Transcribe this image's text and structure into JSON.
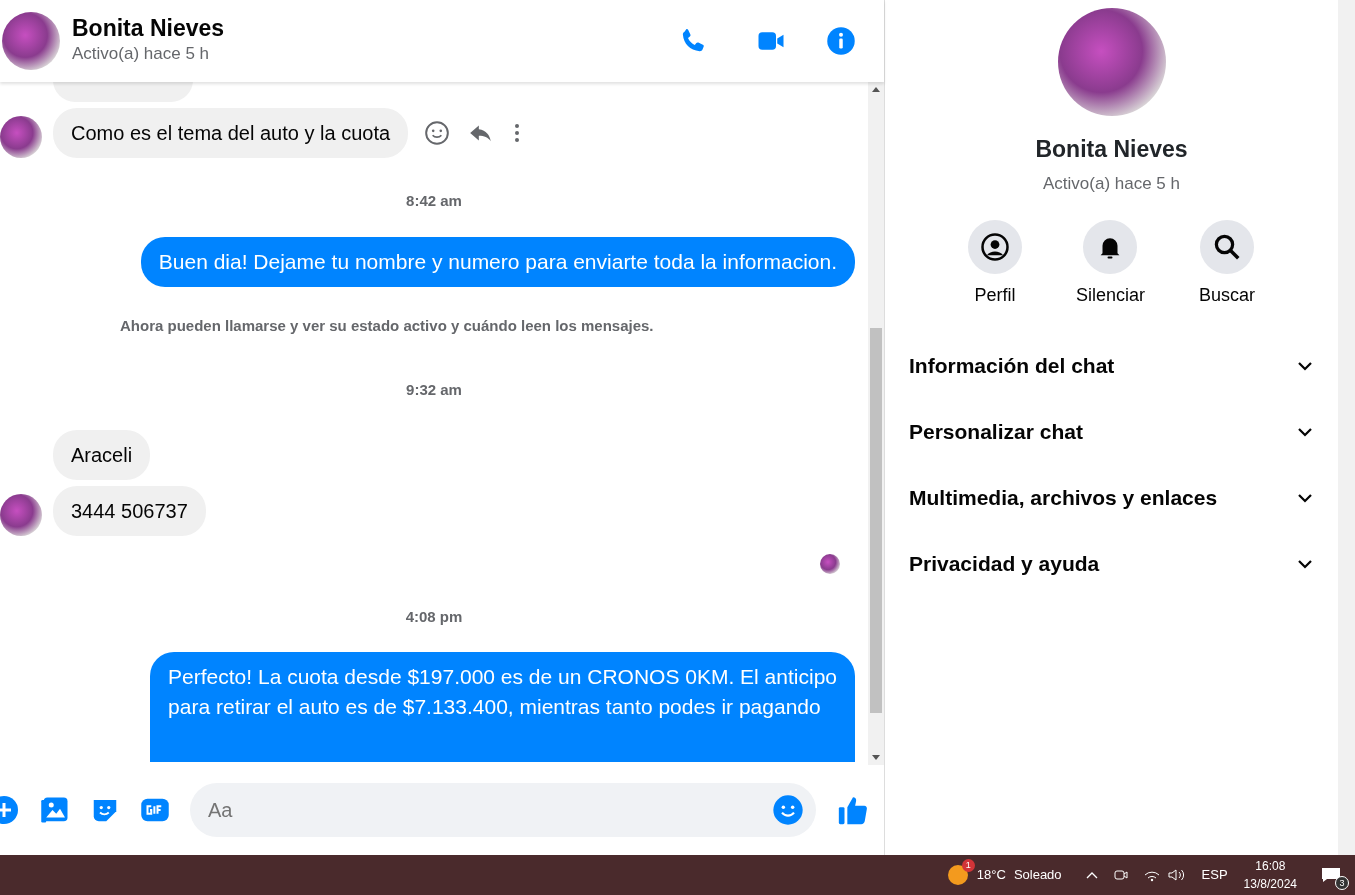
{
  "header": {
    "name": "Bonita Nieves",
    "status": "Activo(a) hace 5 h"
  },
  "messages": [
    {
      "kind": "cut_incoming"
    },
    {
      "kind": "incoming",
      "text": "Como es el tema del auto y la cuota",
      "avatar": true,
      "hover": true
    },
    {
      "kind": "timestamp",
      "text": "8:42 am"
    },
    {
      "kind": "outgoing",
      "text": "Buen dia! Dejame tu nombre y numero para enviarte toda la informacion."
    },
    {
      "kind": "notice",
      "text": "Ahora pueden llamarse y ver su estado activo y cuándo leen los mensajes."
    },
    {
      "kind": "timestamp",
      "text": "9:32 am"
    },
    {
      "kind": "incoming",
      "text": "Araceli",
      "avatar": false,
      "hover": false
    },
    {
      "kind": "incoming",
      "text": "3444 506737",
      "avatar": true,
      "hover": false
    },
    {
      "kind": "read_receipt"
    },
    {
      "kind": "timestamp",
      "text": "4:08 pm"
    },
    {
      "kind": "outgoing_cut",
      "lines": [
        "Perfecto! La cuota desde $197.000 es de un CRONOS 0KM. El anticipo",
        "para retirar el auto es de $7.133.400, mientras tanto podes ir pagando"
      ]
    }
  ],
  "composer": {
    "placeholder": "Aa"
  },
  "panel": {
    "name": "Bonita Nieves",
    "status": "Activo(a) hace 5 h",
    "actions": [
      {
        "kind": "profile",
        "label": "Perfil"
      },
      {
        "kind": "mute",
        "label": "Silenciar"
      },
      {
        "kind": "search",
        "label": "Buscar"
      }
    ],
    "sections": [
      {
        "label": "Información del chat",
        "expanded": false
      },
      {
        "label": "Personalizar chat",
        "expanded": false
      },
      {
        "label": "Multimedia, archivos y enlaces",
        "expanded": false
      },
      {
        "label": "Privacidad y ayuda",
        "expanded": false
      }
    ]
  },
  "taskbar": {
    "weather_badge": "1",
    "temperature": "18°C",
    "condition": "Soleado",
    "language": "ESP",
    "time": "16:08",
    "date": "13/8/2024",
    "notifications": "3"
  }
}
